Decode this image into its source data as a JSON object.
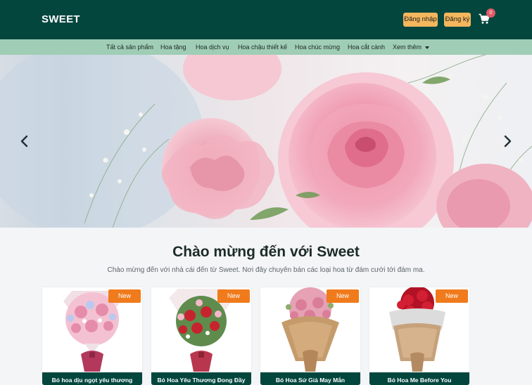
{
  "header": {
    "logo": "SWEET",
    "login_label": "Đăng nhập",
    "register_label": "Đăng ký",
    "cart_count": "0",
    "cart_icon": "shopping-cart-icon"
  },
  "nav": {
    "items": [
      {
        "label": "Tất cả sản phẩm"
      },
      {
        "label": "Hoa tặng"
      },
      {
        "label": "Hoa dịch vụ"
      },
      {
        "label": "Hoa chậu thiết kế"
      },
      {
        "label": "Hoa chúc mừng"
      },
      {
        "label": "Hoa cắt cành"
      },
      {
        "label": "Xem thêm"
      }
    ]
  },
  "hero": {
    "prev_icon": "chevron-left-icon",
    "next_icon": "chevron-right-icon"
  },
  "welcome": {
    "title": "Chào mừng đến với Sweet",
    "subtitle": "Chào mừng đến với nhà cái đến từ Sweet. Nơi đây chuyên bán các loại hoa từ đám cưới tới đám ma."
  },
  "products": [
    {
      "badge": "New",
      "title": "Bó hoa dịu ngọt yêu thương"
    },
    {
      "badge": "New",
      "title": "Bó Hoa Yêu Thương Đong Đầy"
    },
    {
      "badge": "New",
      "title": "Bó Hoa Sứ Giả May Mắn"
    },
    {
      "badge": "New",
      "title": "Bó Hoa Me Before You"
    }
  ],
  "colors": {
    "header_bg": "#02463e",
    "nav_bg": "#9fcdb5",
    "button_bg": "#f5b75d",
    "badge_bg": "#f07b1c",
    "cart_badge_bg": "#e05b66"
  }
}
